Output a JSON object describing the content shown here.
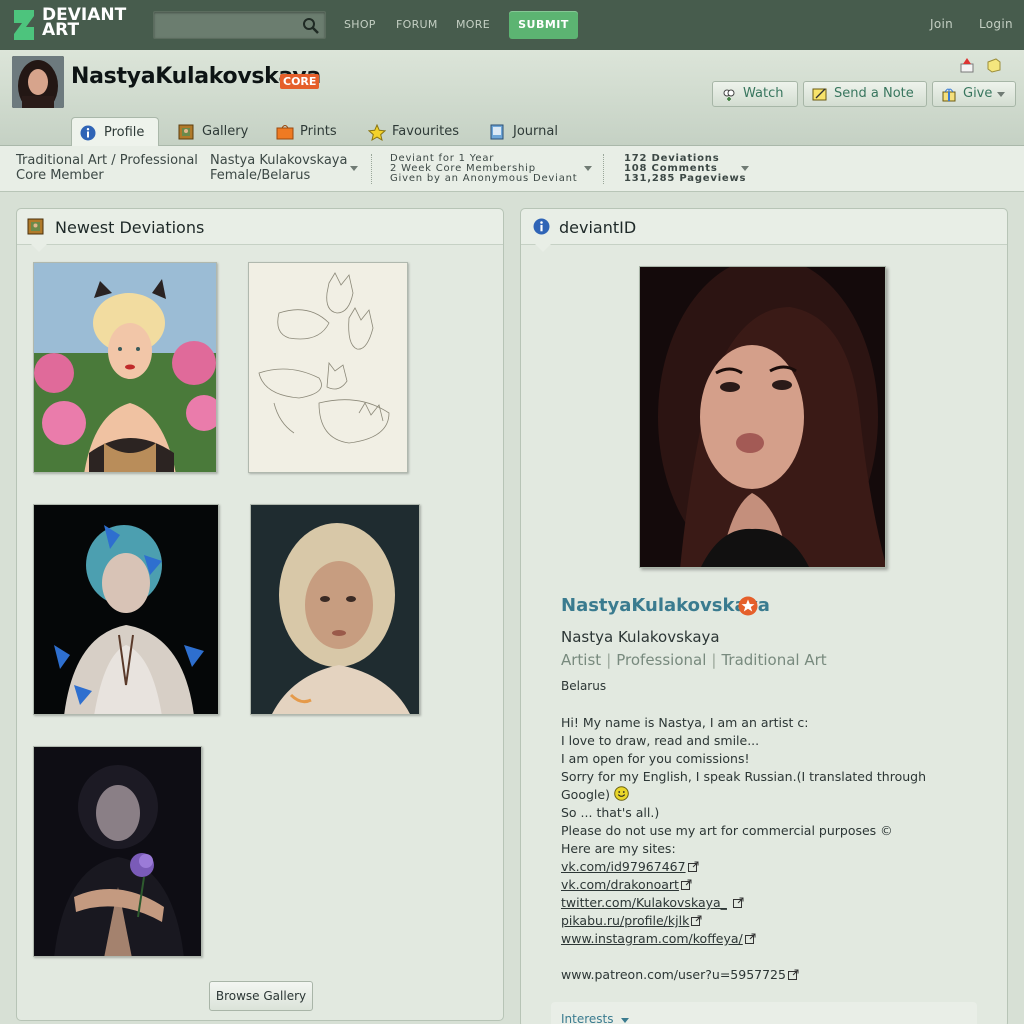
{
  "nav": {
    "logo_line1": "DEVIANT",
    "logo_line2": "ART",
    "search_value": "",
    "links": [
      "SHOP",
      "FORUM",
      "MORE"
    ],
    "submit": "SUBMIT",
    "join": "Join",
    "login": "Login"
  },
  "profile": {
    "username": "NastyaKulakovskaya",
    "badge": "CORE",
    "buttons": {
      "watch": "Watch",
      "note": "Send a Note",
      "give": "Give"
    },
    "tabs": [
      {
        "label": "Profile",
        "icon": "info-icon",
        "active": true
      },
      {
        "label": "Gallery",
        "icon": "gallery-icon"
      },
      {
        "label": "Prints",
        "icon": "prints-icon"
      },
      {
        "label": "Favourites",
        "icon": "star-icon"
      },
      {
        "label": "Journal",
        "icon": "journal-icon"
      }
    ]
  },
  "info": {
    "role_line1": "Traditional Art / Professional",
    "role_line2": "Core Member",
    "name_line1": "Nastya Kulakovskaya",
    "name_line2": "Female/Belarus",
    "membership_line1": "Deviant for 1 Year",
    "membership_line2": "2 Week Core Membership",
    "membership_line3": "Given by an Anonymous Deviant",
    "stats_line1": "172 Deviations",
    "stats_line2": "108 Comments",
    "stats_line3": "131,285 Pageviews"
  },
  "newest": {
    "title": "Newest Deviations",
    "browse": "Browse Gallery"
  },
  "deviantid": {
    "title": "deviantID",
    "username": "NastyaKulakovskaya",
    "realname": "Nastya Kulakovskaya",
    "tag1": "Artist",
    "tag2": "Professional",
    "tag3": "Traditional Art",
    "location": "Belarus",
    "bio": [
      "Hi! My name is Nastya, I am an artist c:",
      "I love to draw, read and smile...",
      "I am open for you comissions!",
      "Sorry for my English, I speak Russian.(I translated through",
      "Google)",
      "So ... that's all.)",
      "Please do not use my art for commercial purposes ©",
      "Here are my sites:"
    ],
    "links": [
      "vk.com/id97967467",
      "vk.com/drakonoart",
      "twitter.com/Kulakovskaya_",
      "pikabu.ru/profile/kjlk",
      "www.instagram.com/koffeya/"
    ],
    "patreon": "www.patreon.com/user?u=5957725",
    "interests": "Interests"
  },
  "colors": {
    "topbar": "#475c4d",
    "submit": "#5cb472",
    "accent": "#3a7b8f",
    "core": "#e55f2a"
  }
}
